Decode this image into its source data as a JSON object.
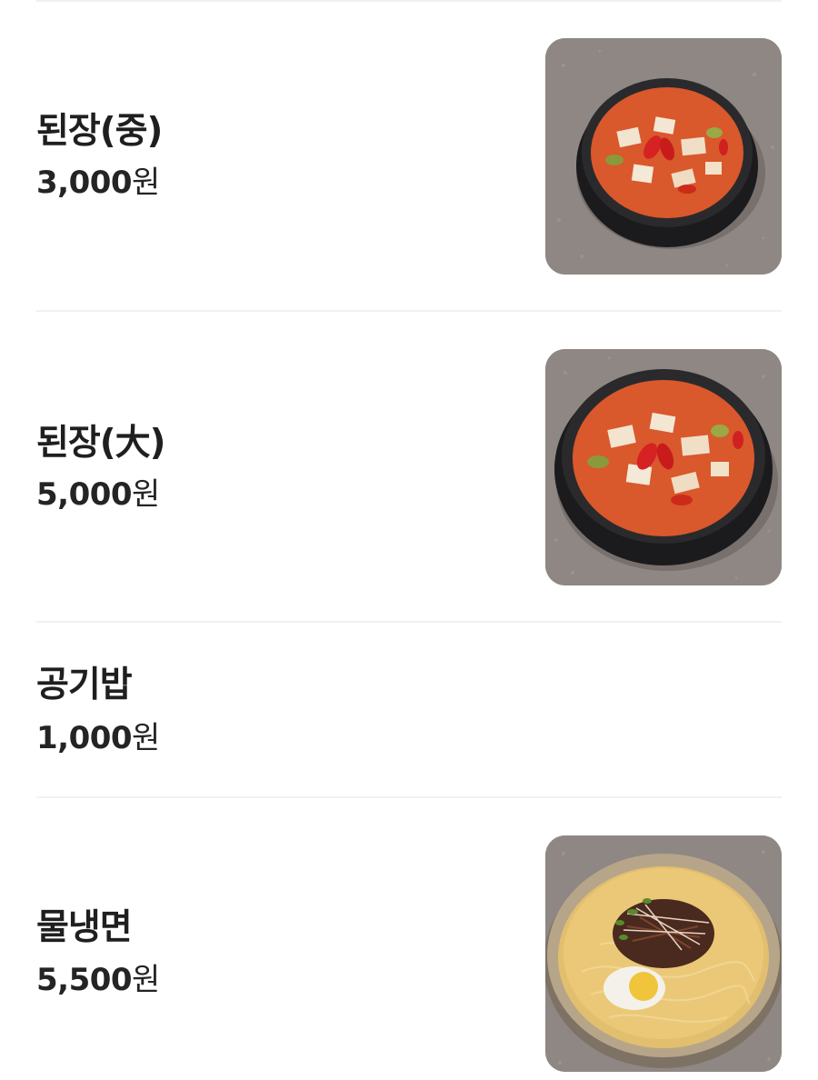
{
  "menu": {
    "items": [
      {
        "name": "된장(중)",
        "price": "3,000",
        "currency": "원",
        "image": "doenjang-stew-photo"
      },
      {
        "name": "된장(大)",
        "price": "5,000",
        "currency": "원",
        "image": "doenjang-stew-photo"
      },
      {
        "name": "공기밥",
        "price": "1,000",
        "currency": "원",
        "image": null
      },
      {
        "name": "물냉면",
        "price": "5,500",
        "currency": "원",
        "image": "cold-noodle-photo"
      }
    ]
  },
  "colors": {
    "text": "#1f1f1f",
    "divider": "#f1f1f1",
    "background": "#ffffff"
  }
}
